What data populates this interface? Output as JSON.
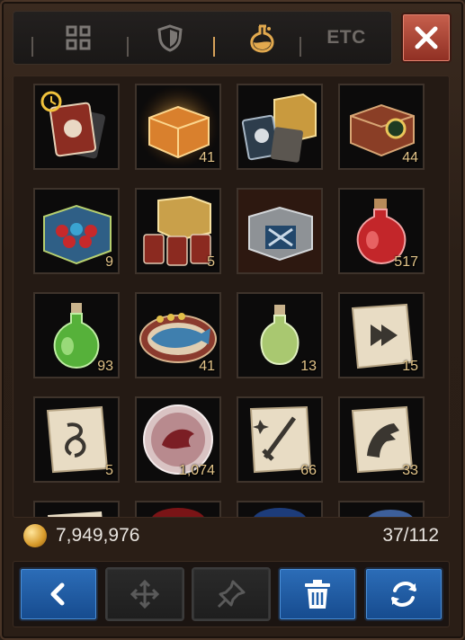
{
  "tabs": [
    {
      "name": "grid",
      "icon": "grid-icon",
      "active": false
    },
    {
      "name": "equipment",
      "icon": "shield-icon",
      "active": false
    },
    {
      "name": "consumables",
      "icon": "potion-icon",
      "active": true
    },
    {
      "name": "etc",
      "label": "ETC",
      "active": false
    }
  ],
  "close_icon": "close-icon",
  "items": [
    {
      "icon": "timed-card-pack-icon",
      "qty": ""
    },
    {
      "icon": "glowing-orange-chest-icon",
      "qty": "41"
    },
    {
      "icon": "card-chest-bundle-icon",
      "qty": ""
    },
    {
      "icon": "engraved-chest-icon",
      "qty": "44"
    },
    {
      "icon": "blue-potion-chest-icon",
      "qty": "9"
    },
    {
      "icon": "gold-chest-cards-icon",
      "qty": "5"
    },
    {
      "icon": "silver-crate-icon",
      "qty": ""
    },
    {
      "icon": "red-potion-icon",
      "qty": "517"
    },
    {
      "icon": "green-potion-icon",
      "qty": "93"
    },
    {
      "icon": "fish-dish-icon",
      "qty": "41"
    },
    {
      "icon": "small-green-potion-icon",
      "qty": "13"
    },
    {
      "icon": "arrow-scroll-icon",
      "qty": "15"
    },
    {
      "icon": "rune-scroll-icon",
      "qty": "5"
    },
    {
      "icon": "dragon-orb-icon",
      "qty": "1,074"
    },
    {
      "icon": "sword-scroll-icon",
      "qty": "66"
    },
    {
      "icon": "horse-scroll-icon",
      "qty": "33"
    }
  ],
  "status": {
    "gold": "7,949,976",
    "capacity": "37/112"
  },
  "toolbar": [
    {
      "icon": "back-arrow-icon",
      "style": "blue"
    },
    {
      "icon": "move-icon",
      "style": "gray"
    },
    {
      "icon": "pin-icon",
      "style": "gray"
    },
    {
      "icon": "trash-icon",
      "style": "blue"
    },
    {
      "icon": "refresh-icon",
      "style": "blue"
    }
  ],
  "colors": {
    "accent": "#d7a25a",
    "qty": "#e3c489",
    "blue_button": "#1f5ea8",
    "close": "#b34c3b"
  }
}
